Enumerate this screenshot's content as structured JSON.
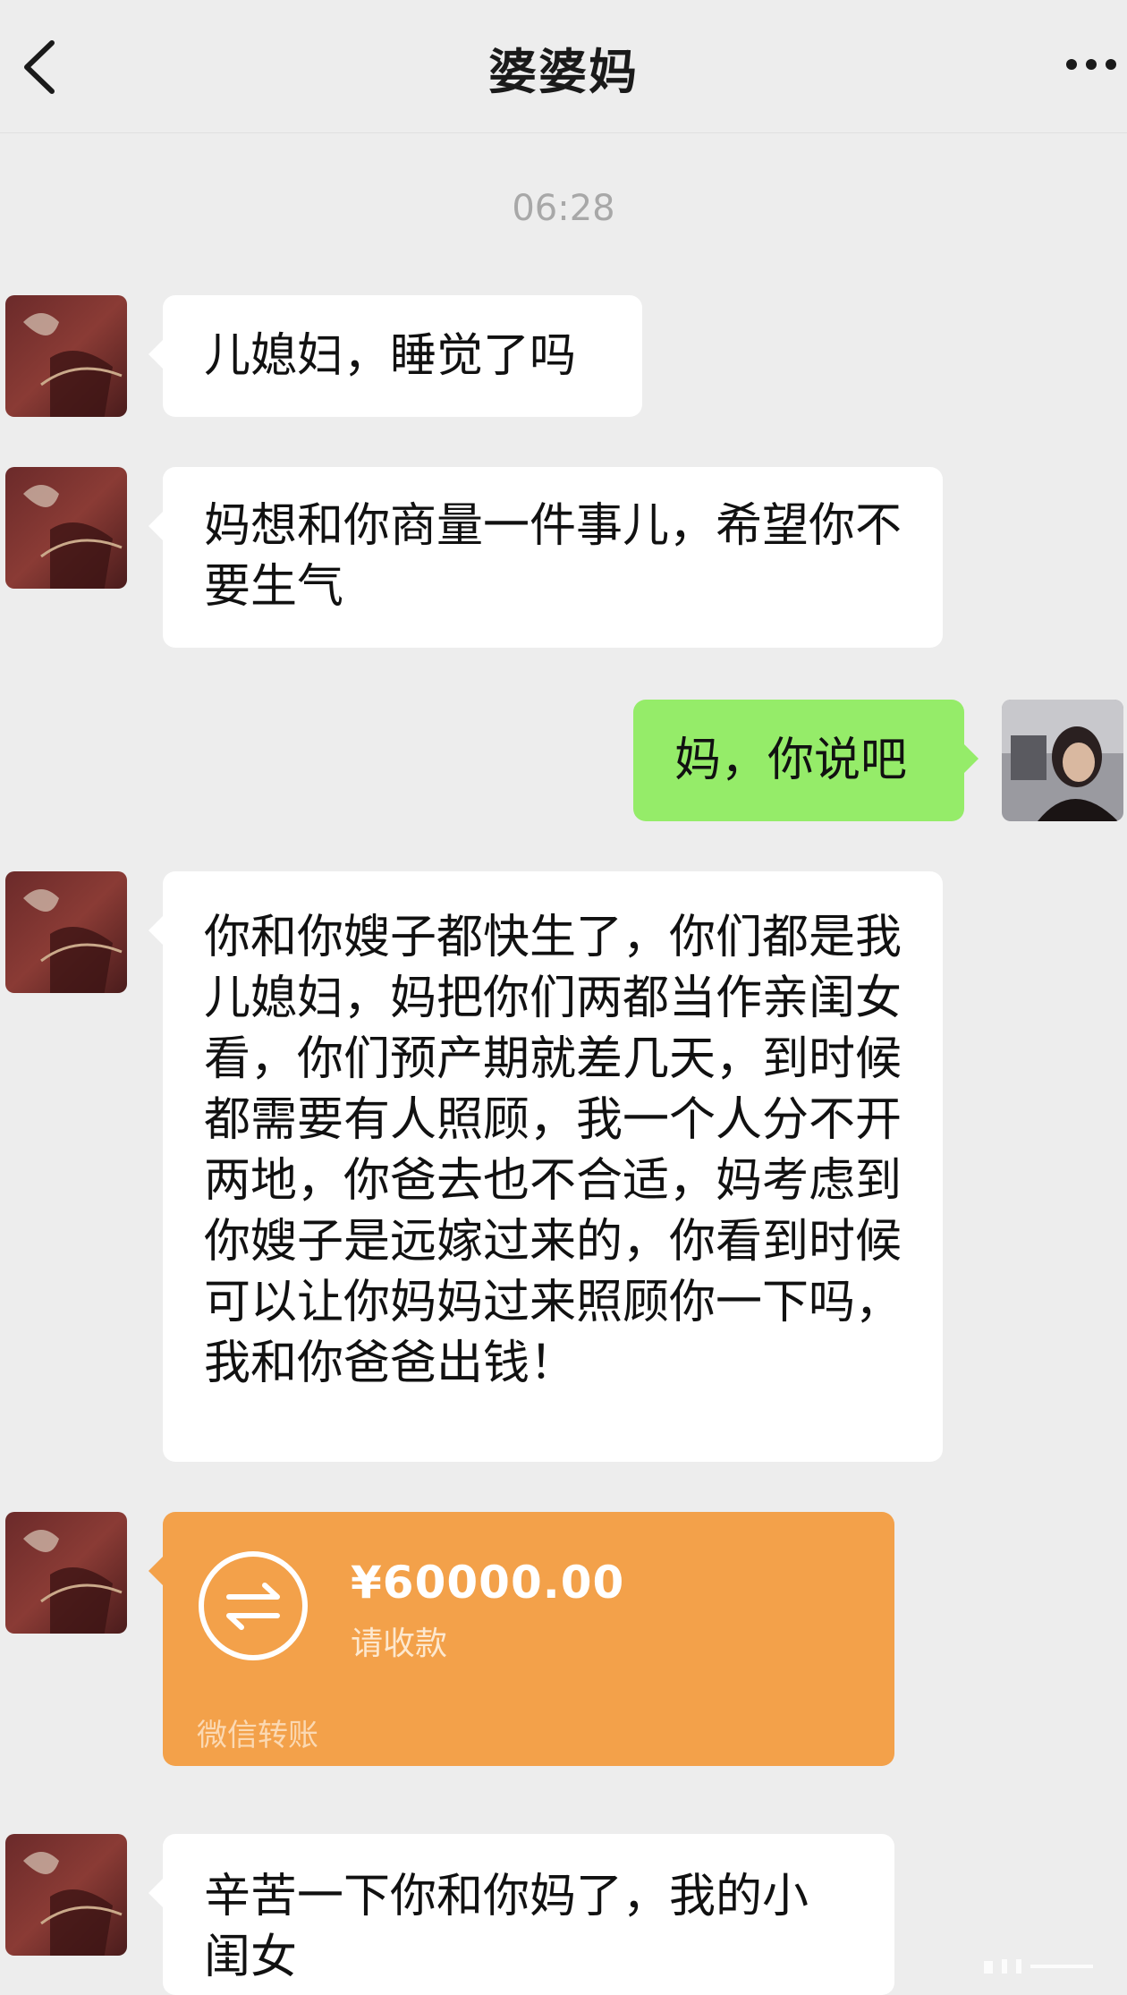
{
  "header": {
    "title": "婆婆妈"
  },
  "timestamp": "06:28",
  "messages": [
    {
      "side": "in",
      "text": "儿媳妇，睡觉了吗"
    },
    {
      "side": "in",
      "text": "妈想和你商量一件事儿，希望你不要生气"
    },
    {
      "side": "out",
      "text": "妈，你说吧"
    },
    {
      "side": "in",
      "text": "你和你嫂子都快生了，你们都是我儿媳妇，妈把你们两都当作亲闺女看，你们预产期就差几天，到时候都需要有人照顾，我一个人分不开两地，你爸去也不合适，妈考虑到你嫂子是远嫁过来的，你看到时候可以让你妈妈过来照顾你一下吗，我和你爸爸出钱！"
    },
    {
      "side": "in",
      "text": "辛苦一下你和你妈了，我的小闺女"
    }
  ],
  "transfer": {
    "amount": "¥60000.00",
    "status": "请收款",
    "footer": "微信转账"
  },
  "icons": {
    "back": "chevron-left-icon",
    "more": "more-dots-icon",
    "transfer": "transfer-arrows-icon"
  },
  "colors": {
    "background": "#ededed",
    "incoming_bubble": "#ffffff",
    "outgoing_bubble": "#95ec69",
    "transfer": "#f3a14a"
  }
}
